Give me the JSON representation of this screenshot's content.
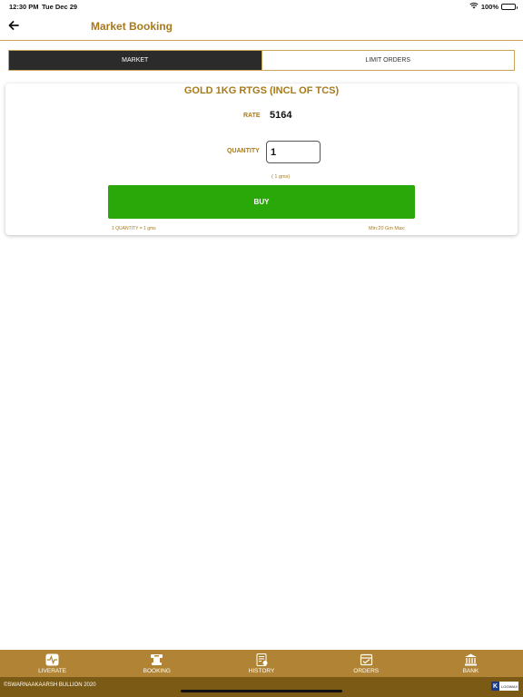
{
  "status": {
    "time": "12:30 PM",
    "date": "Tue Dec 29",
    "battery": "100%"
  },
  "nav": {
    "title": "Market Booking",
    "back_icon": "back-arrow-icon"
  },
  "segments": [
    {
      "label": "MARKET",
      "active": true
    },
    {
      "label": "LIMIT ORDERS",
      "active": false
    }
  ],
  "product": {
    "title": "GOLD 1KG RTGS (INCL OF TCS)",
    "rate_label": "RATE",
    "rate_value": "5164",
    "quantity_label": "QUANTITY",
    "quantity_value": "1",
    "quantity_hint": "( 1 gms)",
    "buy_label": "BUY",
    "note_left": "1 QUANTITY = 1 gms",
    "note_right": "Min:20 Gm Max:"
  },
  "tabs": [
    {
      "label": "LIVERATE",
      "icon": "pulse-icon"
    },
    {
      "label": "BOOKING",
      "icon": "booking-icon"
    },
    {
      "label": "HISTORY",
      "icon": "history-icon"
    },
    {
      "label": "ORDERS",
      "icon": "orders-icon"
    },
    {
      "label": "BANK",
      "icon": "bank-icon"
    }
  ],
  "footer": {
    "copyright": "©SWARNAAKAARSH BULLION 2020",
    "logo_letter": "K",
    "logo_text": "LOGIMAX"
  },
  "colors": {
    "accent": "#a8791b",
    "buy": "#2aa80a",
    "tab_bar": "#b08434",
    "footer": "#7a5a15",
    "segment_active": "#2b2b2b"
  }
}
